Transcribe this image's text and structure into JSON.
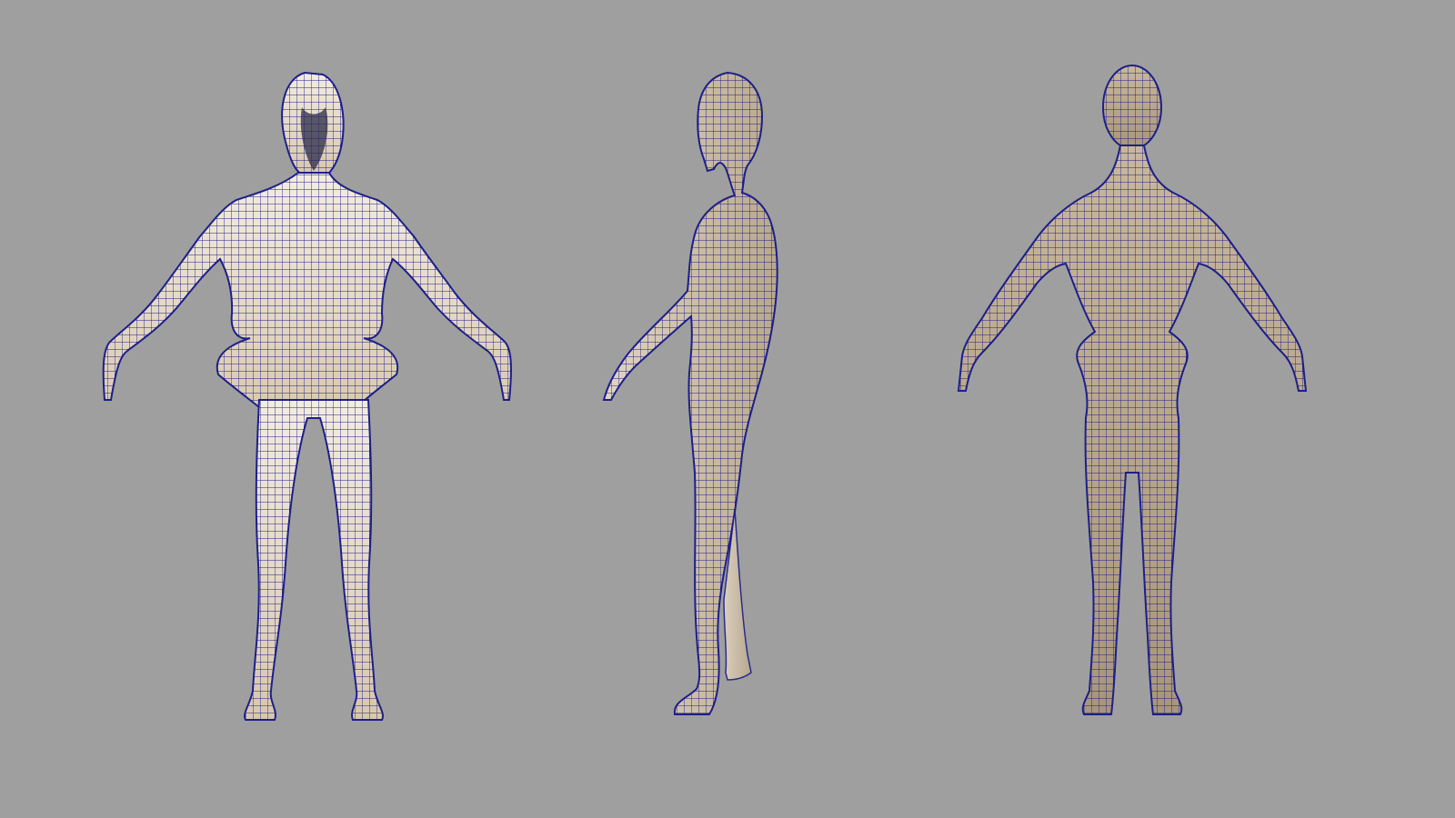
{
  "viewport": {
    "background": "#9f9f9f",
    "skin_color_front": "#e9dccb",
    "skin_color_side": "#cfc0a8",
    "skin_color_back": "#b9a88c",
    "wire_color": "#1c1f8a"
  },
  "models": [
    {
      "view": "front"
    },
    {
      "view": "side"
    },
    {
      "view": "back"
    }
  ]
}
